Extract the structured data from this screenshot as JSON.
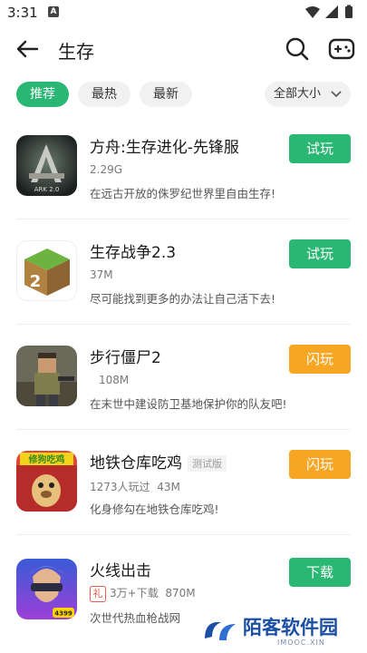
{
  "status": {
    "time": "3:31",
    "app_badge": "A"
  },
  "header": {
    "title": "生存"
  },
  "filters": {
    "chips": [
      {
        "label": "推荐",
        "active": true
      },
      {
        "label": "最热",
        "active": false
      },
      {
        "label": "最新",
        "active": false
      }
    ],
    "size_label": "全部大小"
  },
  "apps": [
    {
      "name": "方舟:生存进化-先锋服",
      "meta": "2.29G",
      "desc": "在远古开放的侏罗纪世界里自由生存!",
      "button": "试玩",
      "button_color": "#2ab673",
      "icon": "ark-game-icon"
    },
    {
      "name": "生存战争2.3",
      "meta": "37M",
      "desc": "尽可能找到更多的办法让自己活下去!",
      "button": "试玩",
      "button_color": "#2ab673",
      "icon": "survivalcraft-icon"
    },
    {
      "name": "步行僵尸2",
      "meta": "108M",
      "desc": "在末世中建设防卫基地保护你的队友吧!",
      "button": "闪玩",
      "button_color": "#f6a623",
      "icon": "walking-zombie-icon"
    },
    {
      "name": "地铁仓库吃鸡",
      "tag": "测试版",
      "players": "1273人玩过",
      "meta": "43M",
      "desc": "化身修勾在地铁仓库吃鸡!",
      "button": "闪玩",
      "button_color": "#f6a623",
      "icon": "dog-game-icon",
      "icon_text": "修狗吃鸡"
    },
    {
      "name": "火线出击",
      "gift": "礼",
      "downloads": "3万+下载",
      "meta": "870M",
      "desc": "次世代热血枪战网",
      "button": "下载",
      "button_color": "#2ab673",
      "icon": "fireline-icon",
      "icon_text": "4399"
    }
  ],
  "watermark": {
    "name": "陌客软件园",
    "sub": "IMOOC.XIN"
  }
}
